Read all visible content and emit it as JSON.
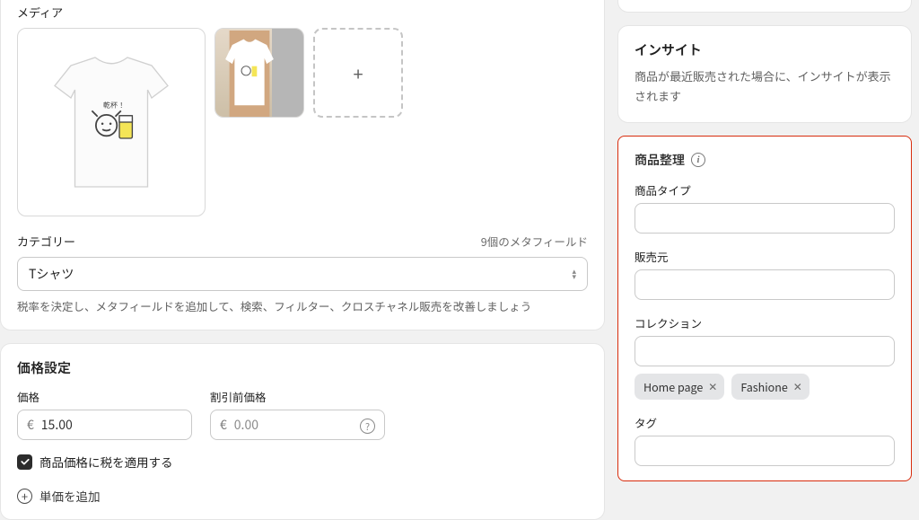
{
  "media": {
    "label": "メディア",
    "add_icon": "+"
  },
  "category": {
    "label": "カテゴリー",
    "metafields_link": "9個のメタフィールド",
    "value": "Tシャツ",
    "help": "税率を決定し、メタフィールドを追加して、検索、フィルター、クロスチャネル販売を改善しましょう"
  },
  "pricing": {
    "title": "価格設定",
    "price_label": "価格",
    "compare_label": "割引前価格",
    "currency": "€",
    "price_value": "15.00",
    "compare_value": "0.00",
    "tax_checkbox": "商品価格に税を適用する",
    "add_unit": "単価を追加"
  },
  "insights": {
    "title": "インサイト",
    "body": "商品が最近販売された場合に、インサイトが表示されます"
  },
  "organization": {
    "title": "商品整理",
    "type_label": "商品タイプ",
    "vendor_label": "販売元",
    "collections_label": "コレクション",
    "tags_title": "タグ",
    "collections": [
      "Home page",
      "Fashione"
    ]
  }
}
